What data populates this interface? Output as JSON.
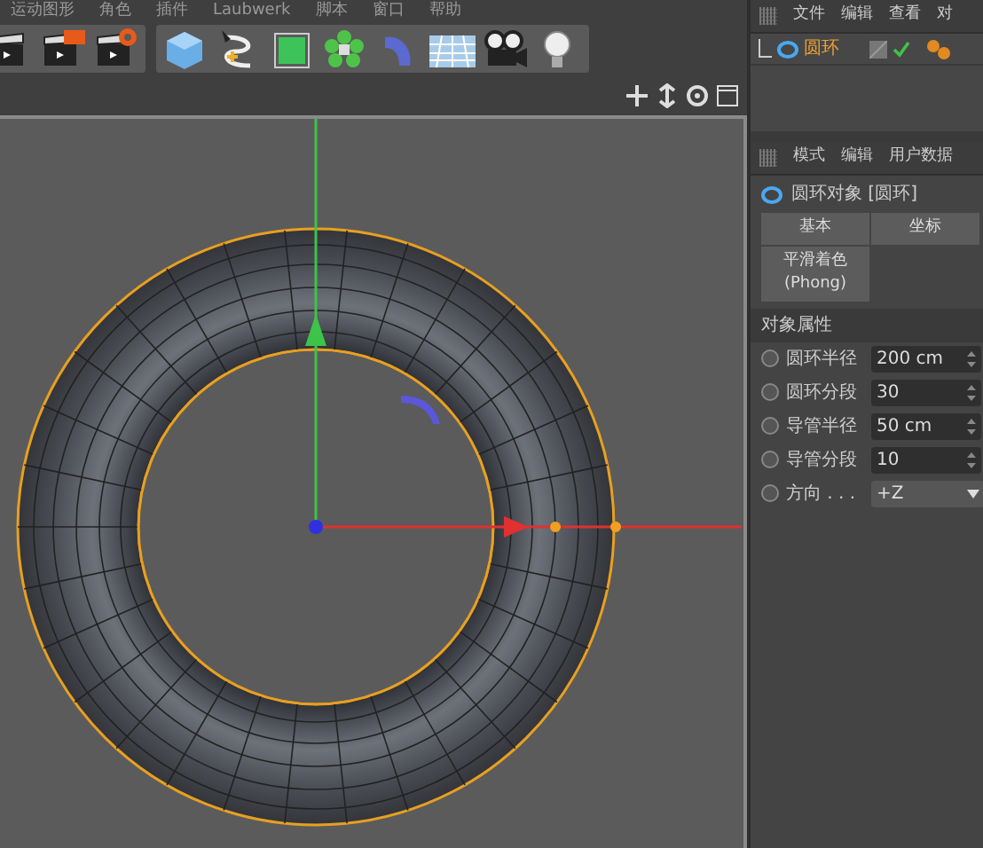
{
  "menu_bar": {
    "items": [
      "运动图形",
      "角色",
      "插件",
      "Laubwerk",
      "脚本",
      "窗口",
      "帮助"
    ]
  },
  "object_manager": {
    "menu": [
      "文件",
      "编辑",
      "查看",
      "对"
    ],
    "objects": [
      {
        "name": "圆环",
        "enabled": true
      }
    ]
  },
  "attributes": {
    "menu": [
      "模式",
      "编辑",
      "用户数据"
    ],
    "title": "圆环对象 [圆环]",
    "tabs": [
      {
        "label": "基本",
        "selected": false
      },
      {
        "label": "坐标",
        "selected": false
      }
    ],
    "subtabs": [
      {
        "label": "平滑着色(Phong)",
        "selected": false
      }
    ],
    "section": "对象属性",
    "fields": [
      {
        "kind": "number",
        "label": "圆环半径",
        "value": "200 cm",
        "checked": false
      },
      {
        "kind": "number",
        "label": "圆环分段",
        "value": "30",
        "checked": false
      },
      {
        "kind": "number",
        "label": "导管半径",
        "value": "50 cm",
        "checked": false
      },
      {
        "kind": "number",
        "label": "导管分段",
        "value": "10",
        "checked": false
      },
      {
        "kind": "dropdown",
        "label": "方向 . . .",
        "value": "+Z",
        "checked": false
      }
    ]
  }
}
